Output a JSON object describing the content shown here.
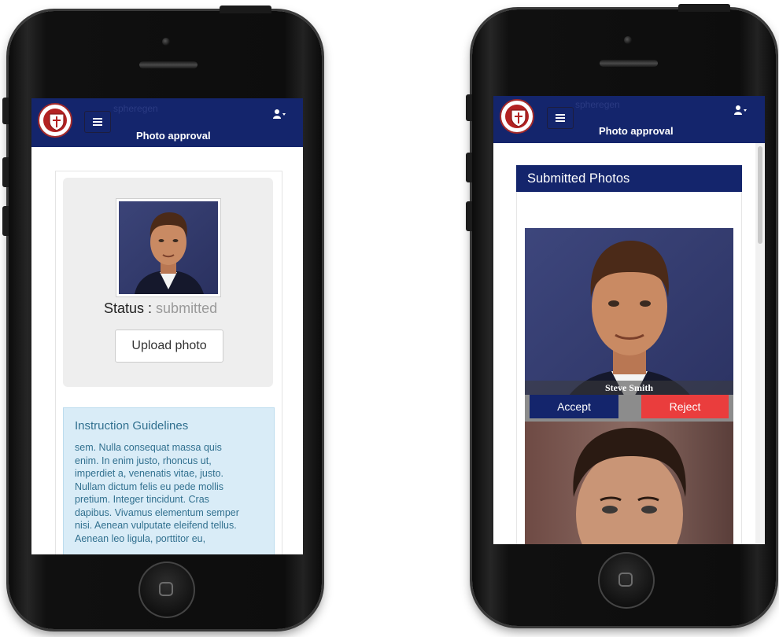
{
  "app": {
    "brand": "spheregen",
    "page_title": "Photo approval"
  },
  "student_screen": {
    "status_label": "Status :",
    "status_value": "submitted",
    "upload_button": "Upload photo",
    "instructions": {
      "title": "Instruction Guidelines",
      "lines": [
        "sem. Nulla consequat massa quis",
        "enim. In enim justo, rhoncus ut,",
        "imperdiet a, venenatis vitae, justo.",
        "Nullam dictum felis eu pede mollis",
        "pretium. Integer tincidunt. Cras",
        "dapibus. Vivamus elementum semper",
        "nisi. Aenean vulputate eleifend tellus.",
        "Aenean leo ligula, porttitor eu,"
      ]
    }
  },
  "admin_screen": {
    "section_title": "Submitted Photos",
    "photos": [
      {
        "caption": "Steve Smith",
        "accept": "Accept",
        "reject": "Reject"
      },
      {
        "caption": ""
      }
    ]
  },
  "colors": {
    "navy": "#14256c",
    "reject_red": "#ea3d3d",
    "info_bg": "#d9ecf7",
    "info_text": "#31708f"
  },
  "icons": {
    "menu": "hamburger-icon",
    "user": "user-icon",
    "logo": "university-seal-logo",
    "home": "home-button"
  }
}
